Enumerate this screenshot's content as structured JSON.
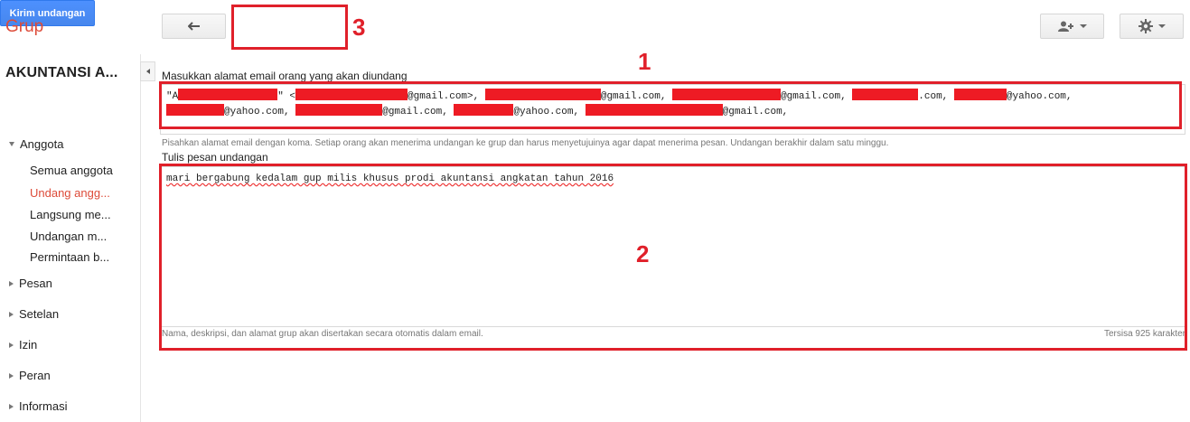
{
  "app": {
    "title": "Grup"
  },
  "toolbar": {
    "back_icon": "back-arrow-icon",
    "send_label": "Kirim undangan",
    "people_icon": "add-people-icon",
    "settings_icon": "gear-icon"
  },
  "annotations": {
    "one": "1",
    "two": "2",
    "three": "3"
  },
  "sidebar": {
    "group_name": "AKUNTANSI A...",
    "sections": [
      {
        "label": "Anggota"
      },
      {
        "label": "Pesan"
      },
      {
        "label": "Setelan"
      },
      {
        "label": "Izin"
      },
      {
        "label": "Peran"
      },
      {
        "label": "Informasi"
      }
    ],
    "members_items": [
      {
        "label": "Semua anggota"
      },
      {
        "label": "Undang angg..."
      },
      {
        "label": "Langsung me..."
      },
      {
        "label": "Undangan m..."
      },
      {
        "label": "Permintaan b..."
      }
    ]
  },
  "invite": {
    "email_label": "Masukkan alamat email orang yang akan diundang",
    "email_line1_parts": [
      "\"A",
      "\" <",
      "@gmail.com>, ",
      "@gmail.com, ",
      "@gmail.com, ",
      ".com, ",
      "@yahoo.com,"
    ],
    "email_line2_parts": [
      "@yahoo.com, ",
      "@gmail.com, ",
      "@yahoo.com, ",
      "@gmail.com,"
    ],
    "email_hint": "Pisahkan alamat email dengan koma. Setiap orang akan menerima undangan ke grup dan harus menyetujuinya agar dapat menerima pesan. Undangan berakhir dalam satu minggu.",
    "message_label": "Tulis pesan undangan",
    "message_value": "mari bergabung kedalam gup milis khusus prodi akuntansi angkatan tahun 2016",
    "message_footer": "Nama, deskripsi, dan alamat grup akan disertakan secara otomatis dalam email.",
    "chars_remaining": "Tersisa 925 karakter"
  }
}
